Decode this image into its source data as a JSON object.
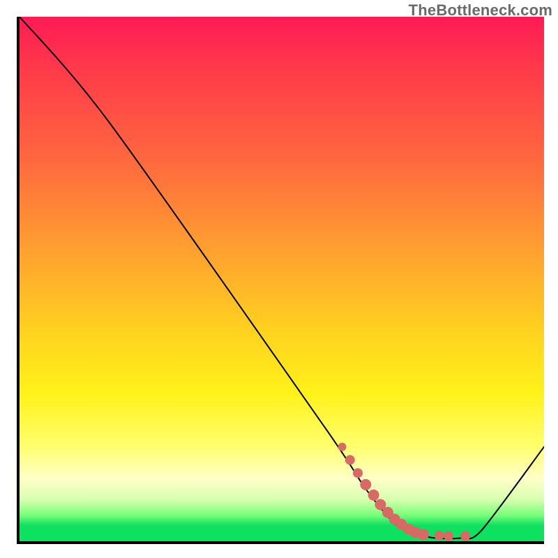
{
  "watermark": "TheBottleneck.com",
  "chart_data": {
    "type": "line",
    "title": "",
    "xlabel": "",
    "ylabel": "",
    "xlim": [
      0,
      1
    ],
    "ylim": [
      0,
      1
    ],
    "grid": false,
    "legend": false,
    "series": [
      {
        "name": "curve",
        "color": "#000000",
        "points": [
          {
            "x": 0.0,
            "y": 1.0
          },
          {
            "x": 0.17,
            "y": 0.8
          },
          {
            "x": 0.58,
            "y": 0.22
          },
          {
            "x": 0.66,
            "y": 0.1
          },
          {
            "x": 0.72,
            "y": 0.03
          },
          {
            "x": 0.78,
            "y": 0.008
          },
          {
            "x": 0.84,
            "y": 0.006
          },
          {
            "x": 0.88,
            "y": 0.02
          },
          {
            "x": 1.0,
            "y": 0.18
          }
        ]
      }
    ],
    "marks": [
      {
        "x": 0.615,
        "y": 0.18,
        "r": 6
      },
      {
        "x": 0.63,
        "y": 0.155,
        "r": 7
      },
      {
        "x": 0.645,
        "y": 0.13,
        "r": 7
      },
      {
        "x": 0.66,
        "y": 0.108,
        "r": 8
      },
      {
        "x": 0.675,
        "y": 0.088,
        "r": 8
      },
      {
        "x": 0.688,
        "y": 0.07,
        "r": 8
      },
      {
        "x": 0.702,
        "y": 0.055,
        "r": 8
      },
      {
        "x": 0.715,
        "y": 0.042,
        "r": 8
      },
      {
        "x": 0.728,
        "y": 0.032,
        "r": 8
      },
      {
        "x": 0.742,
        "y": 0.023,
        "r": 8
      },
      {
        "x": 0.755,
        "y": 0.017,
        "r": 8
      },
      {
        "x": 0.77,
        "y": 0.013,
        "r": 8
      },
      {
        "x": 0.8,
        "y": 0.011,
        "r": 7
      },
      {
        "x": 0.818,
        "y": 0.01,
        "r": 7
      },
      {
        "x": 0.85,
        "y": 0.01,
        "r": 7
      }
    ],
    "marks_color": "#d86a66"
  }
}
